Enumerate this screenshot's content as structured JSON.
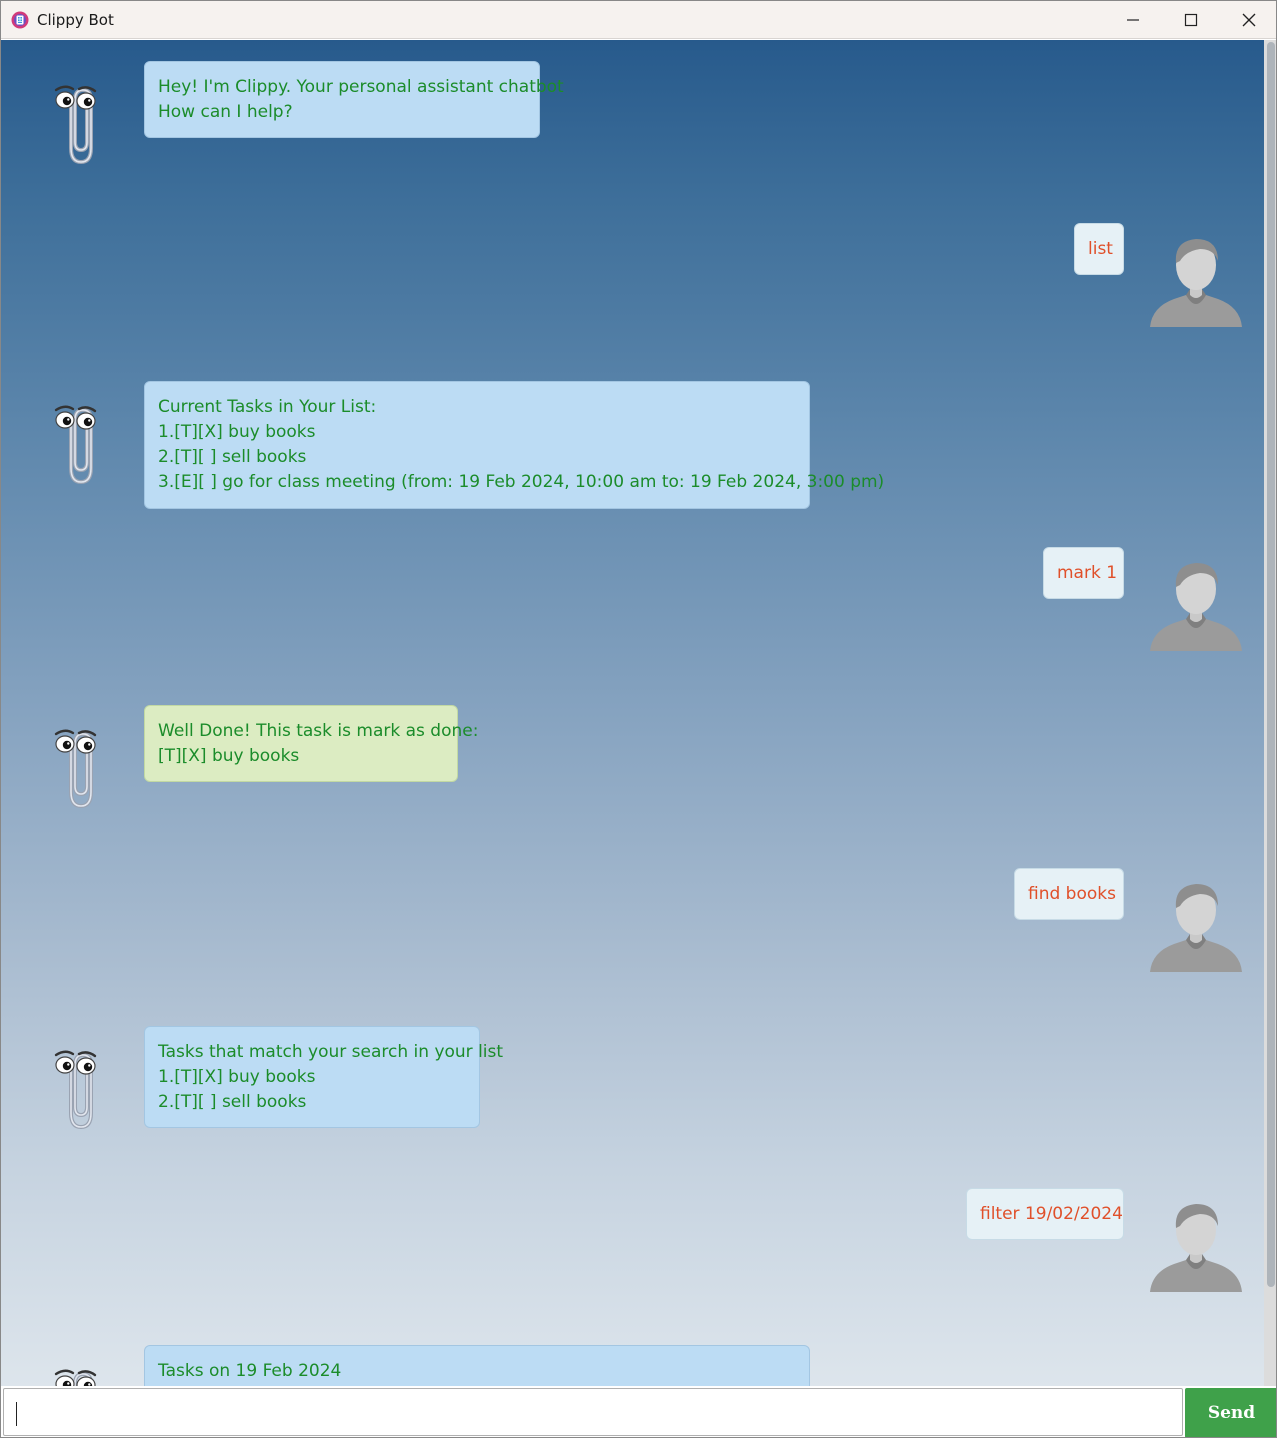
{
  "window": {
    "title": "Clippy Bot"
  },
  "messages": [
    {
      "sender": "bot",
      "lines": "Hey! I'm Clippy. Your personal assistant chatbot\nHow can I help?"
    },
    {
      "sender": "user",
      "lines": "list"
    },
    {
      "sender": "bot",
      "lines": "Current Tasks in Your List:\n1.[T][X] buy books\n2.[T][ ] sell books\n3.[E][ ] go for class meeting (from: 19 Feb 2024, 10:00 am to: 19 Feb 2024, 3:00 pm)"
    },
    {
      "sender": "user",
      "lines": "mark 1"
    },
    {
      "sender": "bot",
      "lines": "Well Done! This task is mark as done:\n[T][X] buy books"
    },
    {
      "sender": "user",
      "lines": "find books"
    },
    {
      "sender": "bot",
      "lines": "Tasks that match your search in your list\n1.[T][X] buy books\n2.[T][ ] sell books"
    },
    {
      "sender": "user",
      "lines": "filter 19/02/2024"
    },
    {
      "sender": "bot",
      "lines": "Tasks on 19 Feb 2024"
    }
  ],
  "input": {
    "value": ""
  },
  "send_button": {
    "label": "Send"
  },
  "colors": {
    "bot_text": "#1b8c2a",
    "user_text": "#e0502a",
    "bot_bubble": "#bcdcf4",
    "done_bubble": "#dcecc2",
    "user_bubble": "#e6f1f6",
    "send_button": "#3fa14a"
  }
}
